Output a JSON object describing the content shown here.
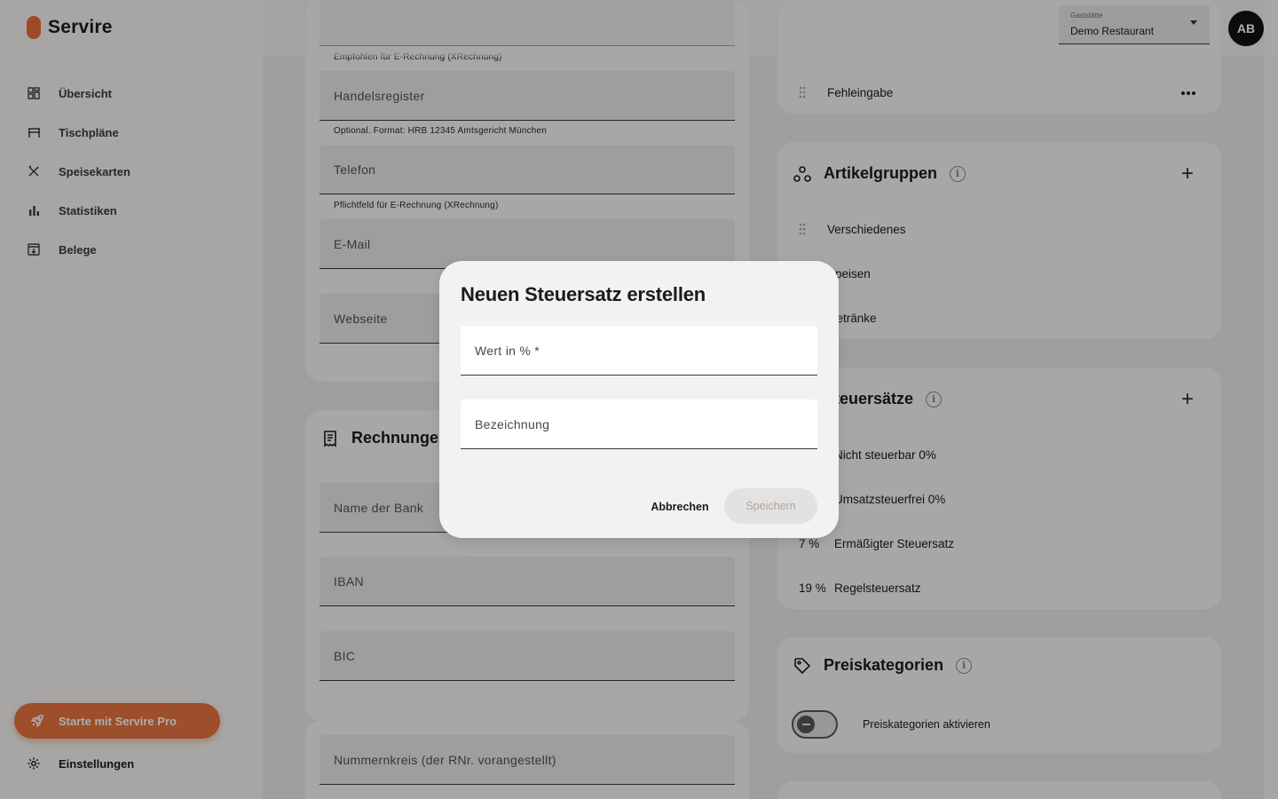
{
  "app": {
    "name": "Servire"
  },
  "sidebar": {
    "items": [
      {
        "label": "Übersicht",
        "icon": "dashboard-icon"
      },
      {
        "label": "Tischpläne",
        "icon": "table-icon"
      },
      {
        "label": "Speisekarten",
        "icon": "cutlery-icon"
      },
      {
        "label": "Statistiken",
        "icon": "bar-chart-icon"
      },
      {
        "label": "Belege",
        "icon": "receipt-box-icon"
      }
    ],
    "pro_button": "Starte mit Servire Pro",
    "settings": "Einstellungen"
  },
  "header": {
    "venue_label": "Gaststätte",
    "venue_value": "Demo Restaurant",
    "avatar_initials": "AB"
  },
  "left_column": {
    "hints": {
      "einvoice_recommended": "Empfohlen für E-Rechnung (XRechnung)",
      "register": "Optional. Format: HRB 12345 Amtsgericht München",
      "phone": "Pflichtfeld für E-Rechnung (XRechnung)"
    },
    "fields": {
      "register": "Handelsregister",
      "phone": "Telefon",
      "email": "E-Mail",
      "website": "Webseite",
      "bank_name": "Name der Bank",
      "iban": "IBAN",
      "bic": "BIC",
      "number_range": "Nummernkreis (der RNr. vorangestellt)"
    },
    "invoices_title": "Rechnungen"
  },
  "right_column": {
    "error_entry": "Fehleingabe",
    "article_groups": {
      "title": "Artikelgruppen",
      "items": [
        "Verschiedenes",
        "Speisen",
        "Getränke"
      ]
    },
    "tax_rates": {
      "title": "Steuersätze",
      "items": [
        {
          "value": "",
          "name": "Nicht steuerbar 0%"
        },
        {
          "value": "",
          "name": "Umsatzsteuerfrei 0%"
        },
        {
          "value": "7 %",
          "name": "Ermäßigter Steuersatz"
        },
        {
          "value": "19 %",
          "name": "Regelsteuersatz"
        }
      ]
    },
    "price_categories": {
      "title": "Preiskategorien",
      "toggle_label": "Preiskategorien aktivieren",
      "enabled": false
    }
  },
  "dialog": {
    "title": "Neuen Steuersatz erstellen",
    "value_field": "Wert in % *",
    "name_field": "Bezeichnung",
    "cancel": "Abbrechen",
    "save": "Speichern"
  },
  "colors": {
    "brand": "#e86e3a",
    "text": "#1d1b1a",
    "overlay": "rgba(0,0,0,0.32)"
  }
}
